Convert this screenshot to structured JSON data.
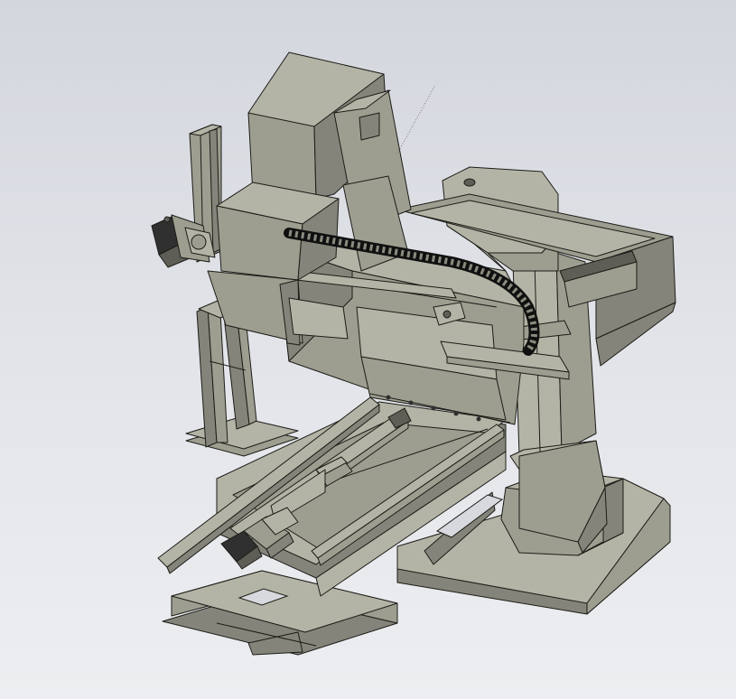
{
  "viewport": {
    "background": [
      "#d3d6dd",
      "#eceef1"
    ],
    "model_color": "#9e9e90",
    "edge_color": "#1c1c18"
  },
  "parts": [
    "base-platform",
    "column-base",
    "column",
    "column-cap",
    "cross-slide-bed",
    "cross-slide-rail",
    "ball-screw",
    "servo-motor-x",
    "servo-motor-z",
    "vertical-slide-column",
    "spindle-head",
    "gearbox-housing",
    "radial-arm",
    "cable-drag-chain",
    "work-table",
    "support-frame"
  ]
}
